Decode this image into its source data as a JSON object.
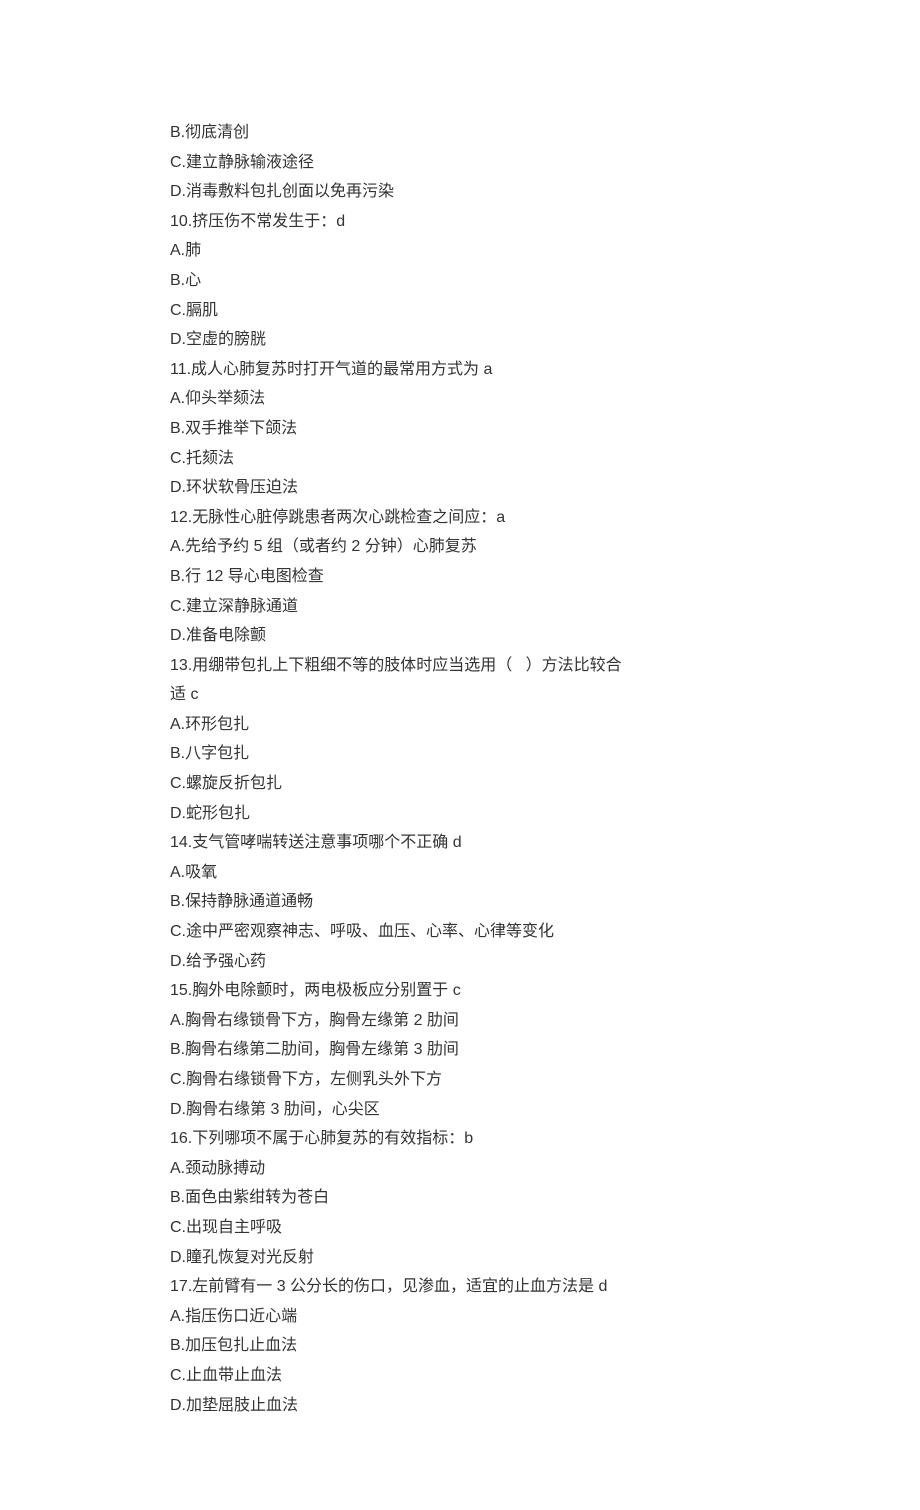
{
  "lines": [
    "B.彻底清创",
    "C.建立静脉输液途径",
    "D.消毒敷料包扎创面以免再污染",
    "10.挤压伤不常发生于：d",
    "A.肺",
    "B.心",
    "C.膈肌",
    "D.空虚的膀胱",
    "11.成人心肺复苏时打开气道的最常用方式为 a",
    "A.仰头举颏法",
    "B.双手推举下颌法",
    "C.托颏法",
    "D.环状软骨压迫法",
    "12.无脉性心脏停跳患者两次心跳检查之间应：a",
    "A.先给予约 5 组（或者约 2 分钟）心肺复苏",
    "B.行 12 导心电图检查",
    "C.建立深静脉通道",
    "D.准备电除颤",
    "13.用绷带包扎上下粗细不等的肢体时应当选用（   ）方法比较合",
    "适 c",
    "A.环形包扎",
    "B.八字包扎",
    "C.螺旋反折包扎",
    "D.蛇形包扎",
    "14.支气管哮喘转送注意事项哪个不正确 d",
    "A.吸氧",
    "B.保持静脉通道通畅",
    "C.途中严密观察神志、呼吸、血压、心率、心律等变化",
    "D.给予强心药",
    "15.胸外电除颤时，两电极板应分别置于 c",
    "A.胸骨右缘锁骨下方，胸骨左缘第 2 肋间",
    "B.胸骨右缘第二肋间，胸骨左缘第 3 肋间",
    "C.胸骨右缘锁骨下方，左侧乳头外下方",
    "D.胸骨右缘第 3 肋间，心尖区",
    "16.下列哪项不属于心肺复苏的有效指标：b",
    "A.颈动脉搏动",
    "B.面色由紫绀转为苍白",
    "C.出现自主呼吸",
    "D.瞳孔恢复对光反射",
    "17.左前臂有一 3 公分长的伤口，见渗血，适宜的止血方法是 d",
    "A.指压伤口近心端",
    "B.加压包扎止血法",
    "C.止血带止血法",
    "D.加垫屈肢止血法"
  ]
}
